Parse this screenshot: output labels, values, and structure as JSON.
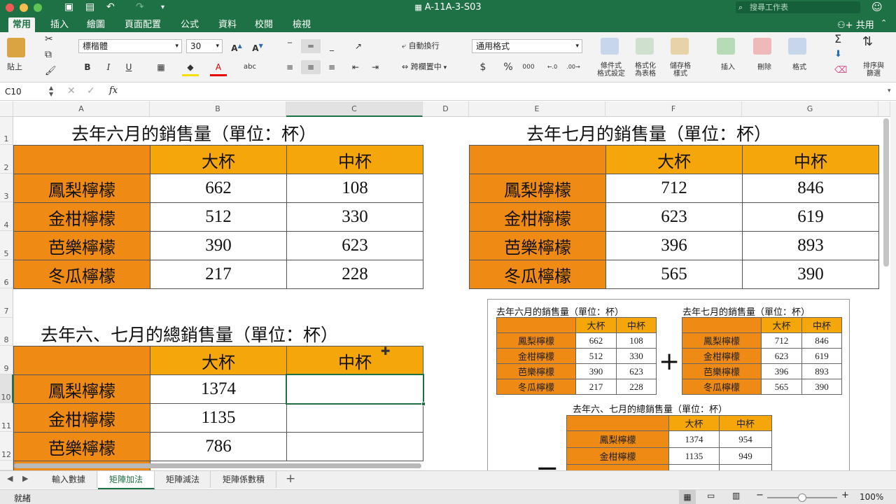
{
  "window": {
    "title": "A-11A-3-S03",
    "search_placeholder": "搜尋工作表",
    "share_label": "共用"
  },
  "ribbon_tabs": [
    "常用",
    "插入",
    "繪圖",
    "頁面配置",
    "公式",
    "資料",
    "校閱",
    "檢視"
  ],
  "ribbon": {
    "paste": "貼上",
    "font_name": "標楷體",
    "font_size": "30",
    "wrap_text": "自動換行",
    "merge_center": "跨欄置中",
    "number_format": "通用格式",
    "cond_format": [
      "條件式",
      "格式設定"
    ],
    "format_table": [
      "格式化",
      "為表格"
    ],
    "cell_styles": [
      "儲存格",
      "樣式"
    ],
    "insert": "插入",
    "delete": "刪除",
    "format": "格式",
    "sort_filter": [
      "排序與",
      "篩選"
    ],
    "bold": "B",
    "italic": "I",
    "underline": "U",
    "dollar": "$",
    "percent": "%",
    "comma": "000",
    "inc_font": "A",
    "dec_font": "A"
  },
  "formula_bar": {
    "cell_ref": "C10",
    "fx": "fx",
    "value": ""
  },
  "columns": [
    "A",
    "B",
    "C",
    "D",
    "E",
    "F",
    "G"
  ],
  "rows": [
    "1",
    "2",
    "3",
    "4",
    "5",
    "6",
    "7",
    "8",
    "9",
    "10",
    "11",
    "12"
  ],
  "june": {
    "title": "去年六月的銷售量（單位：杯）",
    "headers": [
      "大杯",
      "中杯"
    ],
    "labels": [
      "鳳梨檸檬",
      "金柑檸檬",
      "芭樂檸檬",
      "冬瓜檸檬"
    ],
    "large": [
      "662",
      "512",
      "390",
      "217"
    ],
    "medium": [
      "108",
      "330",
      "623",
      "228"
    ]
  },
  "july": {
    "title": "去年七月的銷售量（單位：杯）",
    "headers": [
      "大杯",
      "中杯"
    ],
    "labels": [
      "鳳梨檸檬",
      "金柑檸檬",
      "芭樂檸檬",
      "冬瓜檸檬"
    ],
    "large": [
      "712",
      "623",
      "396",
      "565"
    ],
    "medium": [
      "846",
      "619",
      "893",
      "390"
    ]
  },
  "total": {
    "title": "去年六、七月的總銷售量（單位：杯）",
    "headers": [
      "大杯",
      "中杯"
    ],
    "labels": [
      "鳳梨檸檬",
      "金柑檸檬",
      "芭樂檸檬"
    ],
    "large": [
      "1374",
      "1135",
      "786"
    ],
    "medium": [
      "",
      "",
      ""
    ]
  },
  "picture": {
    "june_title": "去年六月的銷售量（單位：杯）",
    "july_title": "去年七月的銷售量（單位：杯）",
    "total_title": "去年六、七月的總銷售量（單位：杯）",
    "headers": [
      "大杯",
      "中杯"
    ],
    "labels": [
      "鳳梨檸檬",
      "金柑檸檬",
      "芭樂檸檬",
      "冬瓜檸檬"
    ],
    "june_large": [
      "662",
      "512",
      "390",
      "217"
    ],
    "june_medium": [
      "108",
      "330",
      "623",
      "228"
    ],
    "july_large": [
      "712",
      "623",
      "396",
      "565"
    ],
    "july_medium": [
      "846",
      "619",
      "893",
      "390"
    ],
    "total_large": [
      "1374",
      "1135"
    ],
    "total_medium": [
      "954",
      "949"
    ],
    "plus": "+",
    "equals": "="
  },
  "sheet_tabs": [
    "輸入數據",
    "矩陣加法",
    "矩陣減法",
    "矩陣係數積"
  ],
  "active_sheet": "矩陣加法",
  "status": {
    "text": "就緒",
    "zoom": "100%"
  },
  "colors": {
    "brand": "#1e7145",
    "header_fill": "#f5a60a",
    "label_fill": "#ef8a15"
  }
}
